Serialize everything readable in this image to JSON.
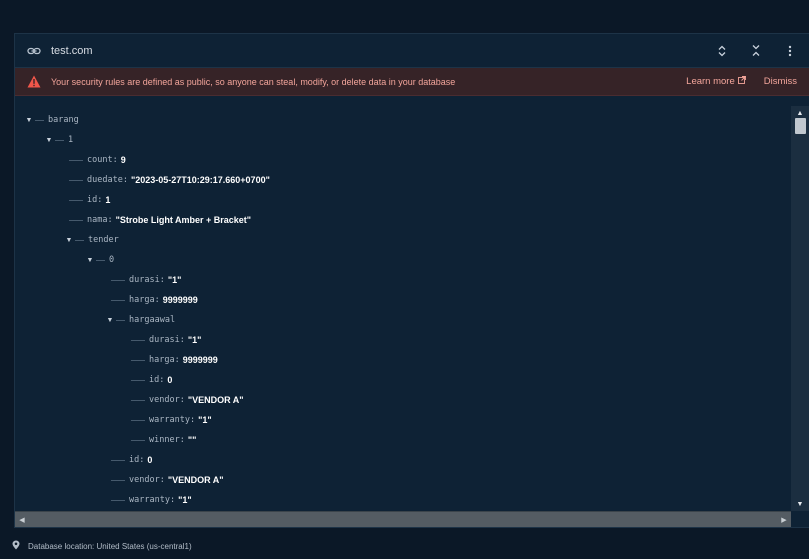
{
  "url_bar": {
    "url": "test.com"
  },
  "warning": {
    "message": "Your security rules are defined as public, so anyone can steal, modify, or delete data in your database",
    "learn_more": "Learn more",
    "dismiss": "Dismiss"
  },
  "tree": [
    {
      "key": "barang",
      "value": "",
      "expandable": true
    },
    {
      "key": "1",
      "value": "",
      "expandable": true
    },
    {
      "key": "count:",
      "value": "9",
      "expandable": false
    },
    {
      "key": "duedate:",
      "value": "\"2023-05-27T10:29:17.660+0700\"",
      "expandable": false
    },
    {
      "key": "id:",
      "value": "1",
      "expandable": false
    },
    {
      "key": "nama:",
      "value": "\"Strobe Light Amber + Bracket\"",
      "expandable": false
    },
    {
      "key": "tender",
      "value": "",
      "expandable": true
    },
    {
      "key": "0",
      "value": "",
      "expandable": true
    },
    {
      "key": "durasi:",
      "value": "\"1\"",
      "expandable": false
    },
    {
      "key": "harga:",
      "value": "9999999",
      "expandable": false
    },
    {
      "key": "hargaawal",
      "value": "",
      "expandable": true
    },
    {
      "key": "durasi:",
      "value": "\"1\"",
      "expandable": false
    },
    {
      "key": "harga:",
      "value": "9999999",
      "expandable": false
    },
    {
      "key": "id:",
      "value": "0",
      "expandable": false
    },
    {
      "key": "vendor:",
      "value": "\"VENDOR A\"",
      "expandable": false
    },
    {
      "key": "warranty:",
      "value": "\"1\"",
      "expandable": false
    },
    {
      "key": "winner:",
      "value": "\"\"",
      "expandable": false
    },
    {
      "key": "id:",
      "value": "0",
      "expandable": false
    },
    {
      "key": "vendor:",
      "value": "\"VENDOR A\"",
      "expandable": false
    },
    {
      "key": "warranty:",
      "value": "\"1\"",
      "expandable": false
    }
  ],
  "footer": {
    "location": "Database location: United States (us-central1)"
  },
  "colors": {
    "background": "#0b1827",
    "panel": "#0e2235",
    "warning_text": "#f3a59b",
    "warning_icon": "#f0564a"
  },
  "icons": [
    "link-icon",
    "expand-all-icon",
    "collapse-all-icon",
    "more-vert-icon",
    "warning-icon",
    "external-link-icon",
    "location-pin-icon"
  ]
}
